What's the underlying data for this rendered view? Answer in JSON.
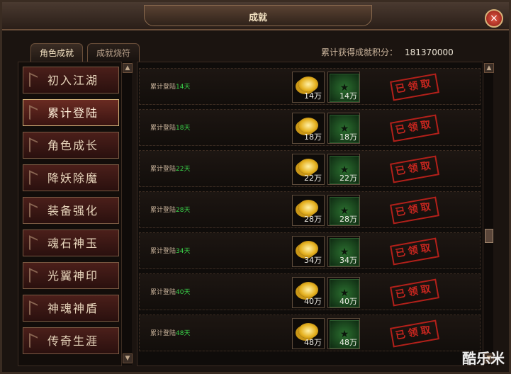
{
  "window": {
    "title": "成就"
  },
  "tabs": [
    {
      "label": "角色成就"
    },
    {
      "label": "成就烧符"
    }
  ],
  "score": {
    "label": "累计获得成就积分：",
    "value": "181370000"
  },
  "categories": [
    {
      "label": "初入江湖"
    },
    {
      "label": "累计登陆"
    },
    {
      "label": "角色成长"
    },
    {
      "label": "降妖除魔"
    },
    {
      "label": "装备强化"
    },
    {
      "label": "魂石神玉"
    },
    {
      "label": "光翼神印"
    },
    {
      "label": "神魂神盾"
    },
    {
      "label": "传奇生涯"
    }
  ],
  "rows": [
    {
      "prefix": "累计登陆",
      "days": "14天",
      "reward1": "14万",
      "reward2": "14万",
      "status": "已领取"
    },
    {
      "prefix": "累计登陆",
      "days": "18天",
      "reward1": "18万",
      "reward2": "18万",
      "status": "已领取"
    },
    {
      "prefix": "累计登陆",
      "days": "22天",
      "reward1": "22万",
      "reward2": "22万",
      "status": "已领取"
    },
    {
      "prefix": "累计登陆",
      "days": "28天",
      "reward1": "28万",
      "reward2": "28万",
      "status": "已领取"
    },
    {
      "prefix": "累计登陆",
      "days": "34天",
      "reward1": "34万",
      "reward2": "34万",
      "status": "已领取"
    },
    {
      "prefix": "累计登陆",
      "days": "40天",
      "reward1": "40万",
      "reward2": "40万",
      "status": "已领取"
    },
    {
      "prefix": "累计登陆",
      "days": "48天",
      "reward1": "48万",
      "reward2": "48万",
      "status": "已领取"
    }
  ],
  "icons": {
    "close": "close-icon",
    "scroll_up": "chevron-up-icon",
    "scroll_down": "chevron-down-icon",
    "coin": "gold-coin-icon",
    "achievement": "achievement-badge-icon",
    "stamp": "claimed-stamp"
  },
  "watermark": "酷乐米",
  "colors": {
    "accent_green": "#3ad54a",
    "stamp_red": "#c7261f"
  }
}
